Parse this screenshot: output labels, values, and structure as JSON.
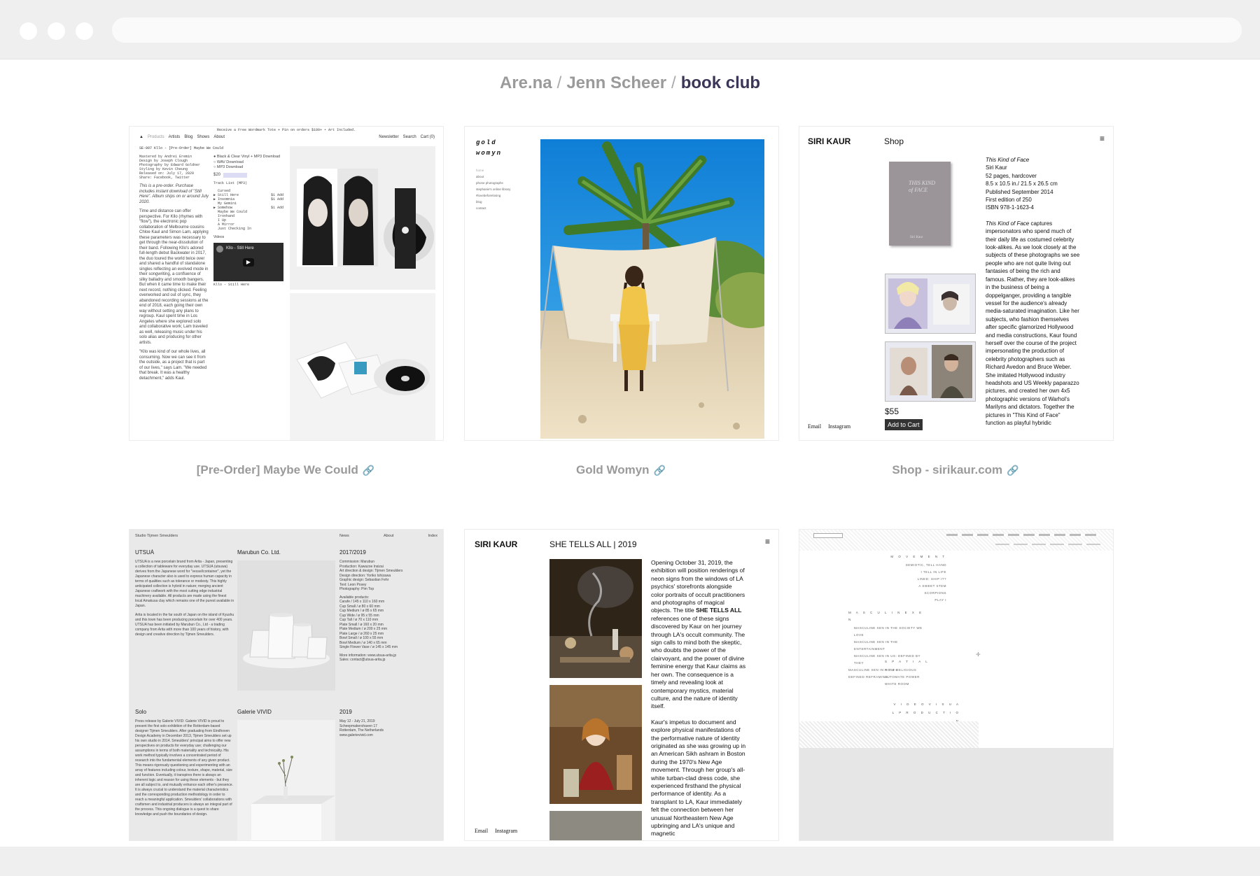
{
  "breadcrumb": {
    "site": "Are.na",
    "user": "Jenn Scheer",
    "channel": "book club",
    "separator": "/"
  },
  "cards": [
    {
      "caption": "[Pre-Order] Maybe We Could",
      "preview": {
        "banner": "Receive a Free Wordmark Tote + Pin on orders $100+ • Art Included.",
        "nav": [
          "Products",
          "Artists",
          "Blog",
          "Shows",
          "About"
        ],
        "nav_right": [
          "Newsletter",
          "Search",
          "Cart (0)"
        ],
        "breadcrumb": "SE-007  Kllo - [Pre-Order] Maybe We Could",
        "credits": [
          "Mastered by Andrei Eremin",
          "Design by Joseph Clough",
          "Photography by Edward Goldner",
          "Styling by Kevin Cheung",
          "Released on: July 17, 2020",
          "Share: Facebook, Twitter"
        ],
        "italic_note": "This is a pre-order. Purchase includes instant download of \"Still Here\". Album ships on or around July 2020.",
        "body": "Time and distance can offer perspective. For Kllo (rhymes with \"flow\"), the electronic pop collaboration of Melbourne cousins Chloe Kaul and Simon Lam, applying these parameters was necessary to get through the near-dissolution of their band. Following Kllo's adored full-length debut Backwater in 2017, the duo toured the world twice over and shared a handful of standalone singles reflecting an evolved mode in their songwriting, a confluence of silky balladry and smooth bangers. But when it came time to make their next record, nothing clicked. Feeling overworked and out of sync, they abandoned recording sessions at the end of 2018, each going their own way without setting any plans to regroup. Kaul spent time in Los Angeles where she explored solo and collaborative work; Lam traveled as well, releasing music under his solo alias and producing for other artists.",
        "quote": "\"Kllo was kind of our whole lives, all consuming. Now we can see it from the outside, as a project that is part of our lives,\" says Lam. \"We needed that break. It was a healthy detachment,\" adds Kaul.",
        "formats": [
          "Black & Clear Vinyl + MP3 Download",
          "WAV Download",
          "MP3 Download"
        ],
        "price": "$20",
        "tracklist_label": "Track List (MP3)",
        "tracks": [
          "Cursed",
          "Still Here",
          "Insomnia",
          "My Gemini",
          "Somehow",
          "Maybe We Could",
          "Ironhand",
          "I Up",
          "A Mirror",
          "Just Checking In"
        ],
        "track_price": "$1",
        "add_label": "Add",
        "videos_label": "Videos",
        "video_title": "Kllo - Still Here",
        "video_caption": "Kllo - Still Here"
      }
    },
    {
      "caption": "Gold Womyn",
      "preview": {
        "logo_line1": "gold",
        "logo_line2": "womyn",
        "menu": [
          "home",
          "about",
          "phone photographs",
          "stephanie's online library",
          "#lovebeforelosing",
          "blog",
          "contact"
        ]
      }
    },
    {
      "caption": "Shop - sirikaur.com",
      "preview": {
        "name": "SIRI KAUR",
        "section": "Shop",
        "menu_icon": "≡",
        "book_cover_title": "THIS KIND of FACE",
        "book_cover_author": "Siri Kaur",
        "title": "This Kind of Face",
        "details": [
          "Siri Kaur",
          "52 pages, hardcover",
          "8.5 x 10.5 in./ 21.5 x 26.5 cm",
          "Published September 2014",
          "First edition of 250",
          "ISBN 978-1-1623-4"
        ],
        "desc_title": "This Kind of Face",
        "description": "captures impersonators who spend much of their daily life as costumed celebrity look-alikes. As we look closely at the subjects of these photographs we see people who are not quite living out fantasies of being the rich and famous. Rather, they are look-alikes in the business of being a doppelganger, providing a tangible vessel for the audience's already media-saturated imagination. Like her subjects, who fashion themselves after specific glamorized Hollywood and media constructions, Kaur found herself over the course of the project impersonating the production of celebrity photographers such as Richard Avedon and Bruce Weber. She imitated Hollywood industry headshots and US Weekly paparazzo pictures, and created her own 4x5 photographic versions of Warhol's Marilyns and dictators. Together the pictures in \"This Kind of Face\" function as playful hybridic",
        "price": "$55",
        "cart_button": "Add to Cart",
        "footer_links": [
          "Email",
          "Instagram"
        ]
      }
    },
    {
      "caption": "",
      "preview": {
        "studio": "Studio Tijmen Smeulders",
        "nav": [
          "News",
          "About",
          "Index"
        ],
        "col1_title": "UTSUÁ",
        "col1_body": "UTSUA is a new porcelain brand from Arita - Japan, presenting a collection of tableware for everyday use. UTSUA (utsuwa) derives from the Japanese word for \"vessel/container\", yet the Japanese character also is used to express human capacity in terms of qualities such as tolerance or modesty. This highly anticipated collection is hybrid in nature; merging ancient Japanese craftwork with the most cutting edge industrial machinery available. All products are made using the finest local Amakusa clay which remains one of the purest available in Japan.",
        "col1_body2": "Arita is located in the far south of Japan on the island of Kyushu and this town has been producing porcelain for over 400 years. UTSUA has been initiated by Marubun Co., Ltd - a trading company from Arita with more than 100 years of history, with design and creative direction by Tijmen Smeulders.",
        "col2_title": "Marubun Co. Ltd.",
        "col3_title": "2017/2019",
        "col3_meta": [
          "Commission: Marubun",
          "Production: Kawazoe Insizai",
          "Art direction & design: Tijmen Smeulders",
          "Design direction: Yoriko Ishizawa",
          "Graphic design: Sebastian Fehr",
          "Text: Leon Posey",
          "Photography: Pim Top"
        ],
        "products_label": "Available products:",
        "products": [
          "Carafe / 145 x 110 x 160 mm",
          "Cup Small / ø 80 x 60 mm",
          "Cup Medium / ø 85 x 65 mm",
          "Cup Wide / ø 95 x 55 mm",
          "Cup Tall / ø 70 x 110 mm",
          "Plate Small / ø 160 x 20 mm",
          "Plate Medium / ø 200 x 25 mm",
          "Plate Large / ø 260 x 25 mm",
          "Bowl Small / ø 100 x 55 mm",
          "Bowl Medium / ø 140 x 65 mm",
          "Single Flower Vase / ø 145 x 145 mm"
        ],
        "more_info": "More information: www.utsua-arita.jp",
        "sales": "Sales: contact@utsua-arita.jp",
        "row2_col1_title": "Solo",
        "row2_col1_body": "Press release by Galerie VIVID: Galerie VIVID is proud to present the first solo exhibition of the Rotterdam-based designer Tijmen Smeulders. After graduating from Eindhoven Design Academy in December 2013, Tijmen Smeulders set up his own studio in 2014. Smeulders' principal aims to offer new perspectives on products for everyday use; challenging our assumptions in terms of both materiality and technicality. His work method typically involves a concentrated period of research into the fundamental elements of any given product. This means rigorously questioning and experimenting with an array of features including colour, texture, shape, material, size and function. Eventually, it transpires there is always an inherent logic and reason for using these elements - but they are all subject to, and mutually enhance each other's presence. It is always crucial to understand the material characteristics and the corresponding production methodology in order to reach a meaningful application. Smeulders' collaborations with craftsmen and industrial producers is always an integral part of the process. This ongoing dialogue is a quest to share knowledge and push the boundaries of design.",
        "row2_col2_title": "Galerie VIVID",
        "row2_col3_title": "2019",
        "row2_col3_meta": [
          "May 12 - July 21, 2019",
          "Scheepmakershaven 17",
          "Rotterdam, The Netherlands",
          "www.galerievivid.com"
        ]
      }
    },
    {
      "caption": "",
      "preview": {
        "name": "SIRI KAUR",
        "section": "SHE TELLS ALL | 2019",
        "menu_icon": "≡",
        "text_p1_a": "Opening October 31, 2019, the exhibition will position renderings of neon signs from the windows of LA psychics' storefronts alongside color portraits of occult practitioners and photographs of magical objects. The title",
        "text_p1_bold": "SHE TELLS ALL",
        "text_p1_b": "references one of these signs discovered by Kaur on her journey through LA's occult community. The sign calls to mind both the skeptic, who doubts the power of the clairvoyant, and the power of divine feminine energy that Kaur claims as her own. The consequence is a timely and revealing look at contemporary mystics, material culture, and the nature of identity itself.",
        "text_p2": "Kaur's impetus to document and explore physical manifestations of the performative nature of identity originated as she was growing up in an American Sikh ashram in Boston during the 1970's New Age movement. Through her group's all-white turban-clad dress code, she experienced firsthand the physical performance of identity. As a transplant to LA, Kaur immediately felt the connection between her unusual Northeastern New Age upbringing and LA's unique and magnetic",
        "footer_links": [
          "Email",
          "Instagram"
        ]
      }
    },
    {
      "caption": "",
      "preview": {
        "groups": [
          {
            "heading": "M O V E M E N T",
            "items": [
              "SEMIOTIC, TELL HAND",
              "I TELL IN LIFE",
              "LINED: SHIP IT?",
              "A SWEET STEM",
              "SCORPIONS",
              "PLAY I"
            ]
          },
          {
            "heading": "M A S C U L I N E   X E N",
            "items": [
              "MASCULINE XEN IN THE SOCIETY WE LOVE",
              "MASCULINE XEN IN THE ENTERTAINMENT",
              "MASCULINE XEN IN US: DEFINED BY THEY",
              "MASCULINE XEN IN POST-RELIGIOUS DEFINED REFRAMING"
            ]
          },
          {
            "heading": "S P A T I A L",
            "items": [
              "N Y & L",
              "AUTOMATE POWER",
              "WHITE ROOM"
            ]
          },
          {
            "heading": "V I D E O   V I S U A L   P R O D U C T I O N",
            "items": []
          }
        ]
      }
    }
  ],
  "link_icon": "link-icon"
}
